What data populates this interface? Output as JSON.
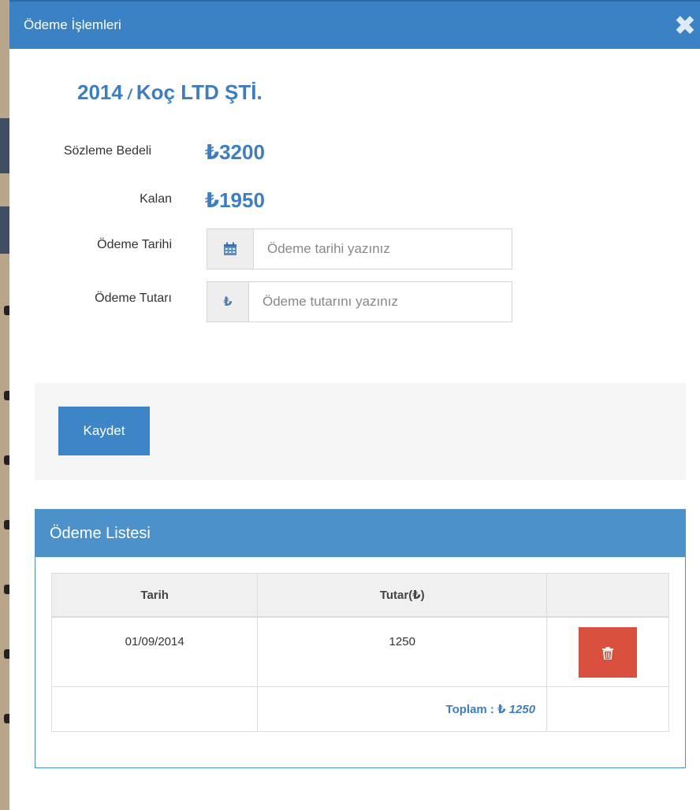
{
  "modal": {
    "title": "Ödeme İşlemleri",
    "close_glyph": "✖",
    "company_year": "2014",
    "company_sep": "/",
    "company_name": "Koç LTD ŞTİ."
  },
  "contract": {
    "price_label": "Sözleme Bedeli",
    "price_value": "₺3200",
    "remaining_label": "Kalan",
    "remaining_value": "₺1950"
  },
  "form": {
    "date_label": "Ödeme Tarihi",
    "date_placeholder": "Ödeme tarihi yazınız",
    "amount_label": "Ödeme Tutarı",
    "amount_placeholder": "Ödeme tutarını yazınız",
    "currency_glyph": "₺",
    "save_label": "Kaydet"
  },
  "payments": {
    "title": "Ödeme Listesi",
    "columns": [
      "Tarih",
      "Tutar(₺)",
      ""
    ],
    "rows": [
      {
        "date": "01/09/2014",
        "amount": "1250"
      }
    ],
    "total_label": "Toplam : ₺",
    "total_value": "1250"
  },
  "colors": {
    "primary": "#3b82c4",
    "danger": "#d9503f",
    "accent_text": "#3d7ec0"
  },
  "icons": {
    "calendar": "calendar-icon",
    "currency": "lira-icon",
    "delete": "trash-icon",
    "close": "close-icon"
  }
}
